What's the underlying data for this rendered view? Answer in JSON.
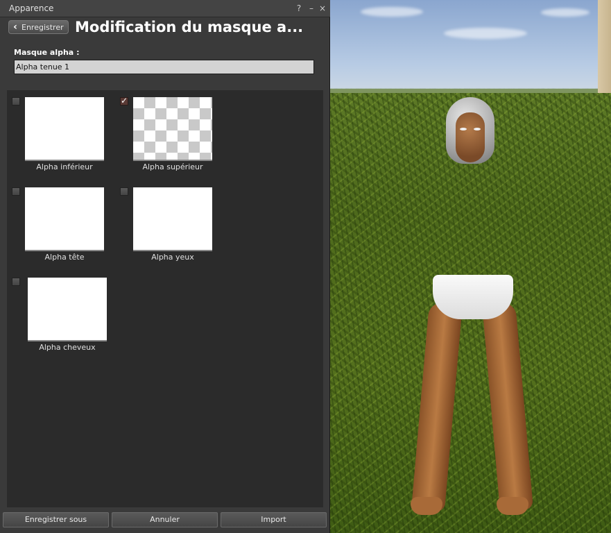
{
  "window": {
    "title": "Apparence",
    "controls": {
      "help": "?",
      "minimize": "–",
      "close": "×"
    }
  },
  "header": {
    "back_label": "Enregistrer",
    "panel_title": "Modification du masque a..."
  },
  "form": {
    "name_label": "Masque alpha :",
    "name_value": "Alpha tenue 1"
  },
  "alpha_items": [
    {
      "label": "Alpha inférieur",
      "checked": false,
      "pattern": "white"
    },
    {
      "label": "Alpha supérieur",
      "checked": true,
      "pattern": "checker"
    },
    {
      "label": "Alpha tête",
      "checked": false,
      "pattern": "white"
    },
    {
      "label": "Alpha yeux",
      "checked": false,
      "pattern": "white"
    },
    {
      "label": "Alpha cheveux",
      "checked": false,
      "pattern": "white"
    }
  ],
  "footer": {
    "save_as": "Enregistrer sous",
    "cancel": "Annuler",
    "import": "Import"
  },
  "icons": {
    "back": "chevron-left-icon",
    "check": "checkmark-icon"
  }
}
